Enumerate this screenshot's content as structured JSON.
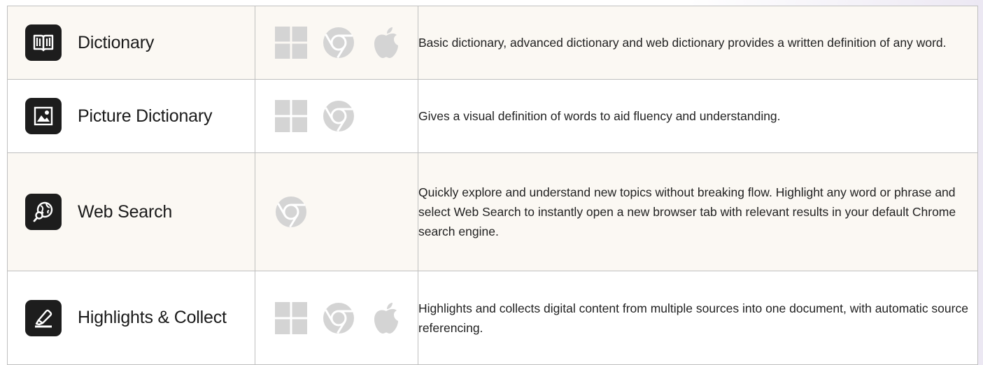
{
  "colors": {
    "border": "#bfbfbf",
    "row_alt_bg": "#fbf8f3",
    "icon_bg": "#1d1d1d",
    "platform_icon": "#d4d4d4"
  },
  "features": [
    {
      "name": "Dictionary",
      "icon": "book-icon",
      "platforms": [
        "windows-icon",
        "chrome-icon",
        "apple-icon"
      ],
      "description": "Basic dictionary, advanced dictionary and web dictionary provides a written definition of any word."
    },
    {
      "name": "Picture Dictionary",
      "icon": "picture-icon",
      "platforms": [
        "windows-icon",
        "chrome-icon"
      ],
      "description": "Gives a visual definition of words to aid fluency and understanding."
    },
    {
      "name": "Web Search",
      "icon": "globe-search-icon",
      "platforms": [
        "chrome-icon"
      ],
      "description": "Quickly explore and understand new topics without breaking flow. Highlight any word or phrase and select Web Search to instantly open a new browser tab with relevant results in your default Chrome search engine."
    },
    {
      "name": "Highlights & Collect",
      "icon": "highlighter-icon",
      "platforms": [
        "windows-icon",
        "chrome-icon",
        "apple-icon"
      ],
      "description": "Highlights and collects digital content from multiple sources into one document, with automatic source referencing."
    }
  ]
}
